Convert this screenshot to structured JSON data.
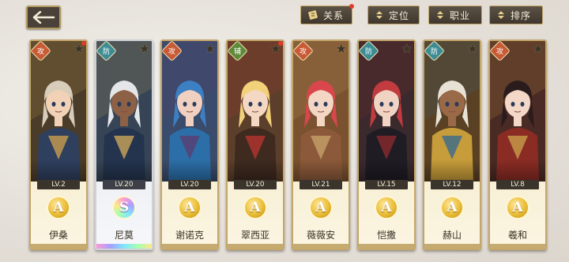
{
  "header": {
    "relations_label": "关系",
    "position_label": "定位",
    "class_label": "职业",
    "sort_label": "排序"
  },
  "characters": [
    {
      "name": "伊桑",
      "level": "LV.2",
      "rank": "A",
      "type": "攻",
      "palette": {
        "bg": "#4b3c2a",
        "hair": "#d8cdbb",
        "skin": "#f1d2b6",
        "outfit": "#2f3f5e",
        "accent": "#c99d4c"
      }
    },
    {
      "name": "尼莫",
      "level": "LV.20",
      "rank": "S",
      "type": "防",
      "palette": {
        "bg": "#364456",
        "hair": "#e4e6ea",
        "skin": "#8d6146",
        "outfit": "#24344e",
        "accent": "#caa55a"
      }
    },
    {
      "name": "谢诺克",
      "level": "LV.20",
      "rank": "A",
      "type": "攻",
      "palette": {
        "bg": "#3b4b6b",
        "hair": "#3c7fc2",
        "skin": "#f0d0c0",
        "outfit": "#2c6fa8",
        "accent": "#5a3f72"
      }
    },
    {
      "name": "翠西亚",
      "level": "LV.20",
      "rank": "A",
      "type": "辅",
      "palette": {
        "bg": "#5c3f2a",
        "hair": "#f1d27a",
        "skin": "#f4d8c4",
        "outfit": "#3e2a1f",
        "accent": "#b4352e"
      }
    },
    {
      "name": "薇薇安",
      "level": "LV.21",
      "rank": "A",
      "type": "攻",
      "palette": {
        "bg": "#7a5230",
        "hair": "#d9464c",
        "skin": "#f3d6c4",
        "outfit": "#8c5a3a",
        "accent": "#c4a06a"
      }
    },
    {
      "name": "恺撒",
      "level": "LV.15",
      "rank": "A",
      "type": "防",
      "palette": {
        "bg": "#3a2a2e",
        "hair": "#c13b3f",
        "skin": "#f1d3c4",
        "outfit": "#1f1c24",
        "accent": "#8a2a2c"
      }
    },
    {
      "name": "赫山",
      "level": "LV.12",
      "rank": "A",
      "type": "防",
      "palette": {
        "bg": "#5a4124",
        "hair": "#e8e2d6",
        "skin": "#9a6a48",
        "outfit": "#c79c3a",
        "accent": "#3a6a8c"
      }
    },
    {
      "name": "羲和",
      "level": "LV.8",
      "rank": "A",
      "type": "攻",
      "palette": {
        "bg": "#4a2a24",
        "hair": "#2a1c1c",
        "skin": "#f3d8c8",
        "outfit": "#8a2c24",
        "accent": "#c79c4a"
      }
    }
  ]
}
